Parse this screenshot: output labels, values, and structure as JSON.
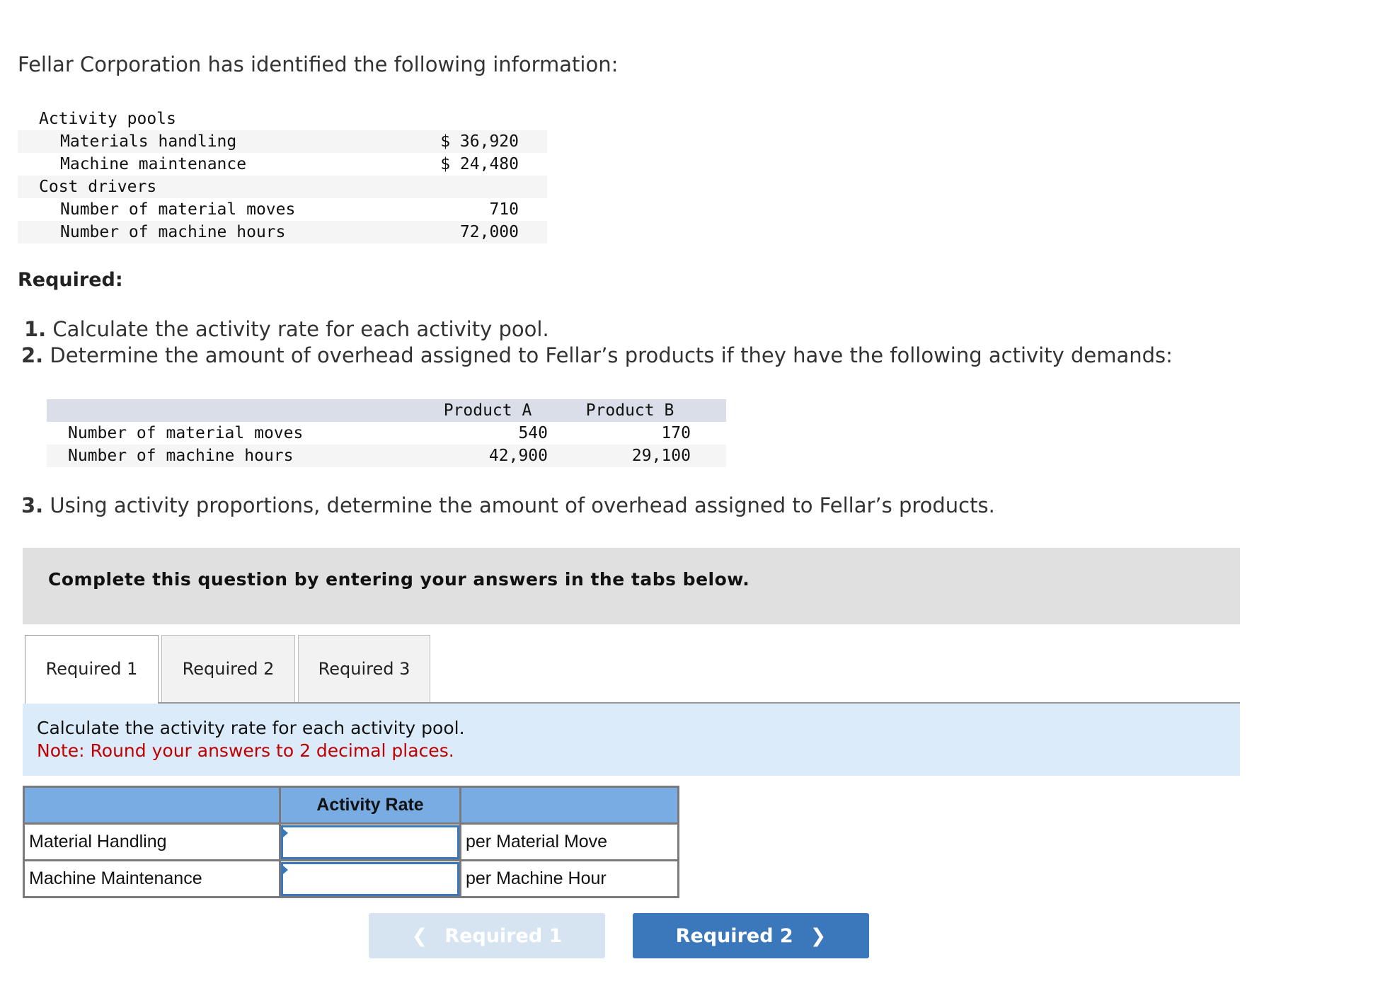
{
  "intro": "Fellar Corporation has identified the following information:",
  "info_table": [
    {
      "label": "Activity pools",
      "value": "",
      "indent": 0
    },
    {
      "label": "Materials handling",
      "value": "$ 36,920",
      "indent": 1
    },
    {
      "label": "Machine maintenance",
      "value": "$ 24,480",
      "indent": 1
    },
    {
      "label": "Cost drivers",
      "value": "",
      "indent": 0
    },
    {
      "label": "Number of material moves",
      "value": "710",
      "indent": 1
    },
    {
      "label": "Number of machine hours",
      "value": "72,000",
      "indent": 1
    }
  ],
  "required_heading": "Required:",
  "requirements": [
    {
      "num": "1.",
      "text": "Calculate the activity rate for each activity pool."
    },
    {
      "num": "2.",
      "text": "Determine the amount of overhead assigned to Fellar’s products if they have the following activity demands:"
    },
    {
      "num": "3.",
      "text": "Using activity proportions, determine the amount of overhead assigned to Fellar’s products."
    }
  ],
  "demand_table": {
    "headers": [
      "Product A",
      "Product B"
    ],
    "rows": [
      {
        "label": "Number of material moves",
        "a": "540",
        "b": "170"
      },
      {
        "label": "Number of machine hours",
        "a": "42,900",
        "b": "29,100"
      }
    ]
  },
  "instruction_banner": "Complete this question by entering your answers in the tabs below.",
  "tabs": [
    "Required 1",
    "Required 2",
    "Required 3"
  ],
  "active_tab": 0,
  "tab_prompt": "Calculate the activity rate for each activity pool.",
  "tab_note": "Note: Round your answers to 2 decimal places.",
  "answer_table": {
    "header": "Activity Rate",
    "rows": [
      {
        "label": "Material Handling",
        "value": "",
        "unit": "per Material Move"
      },
      {
        "label": "Machine Maintenance",
        "value": "",
        "unit": "per Machine Hour"
      }
    ]
  },
  "nav": {
    "prev": "Required 1",
    "next": "Required 2"
  },
  "colors": {
    "accent": "#3a77bb",
    "table_header": "#78ace3",
    "note": "#c00000",
    "prompt_bg": "#dbebf9"
  }
}
